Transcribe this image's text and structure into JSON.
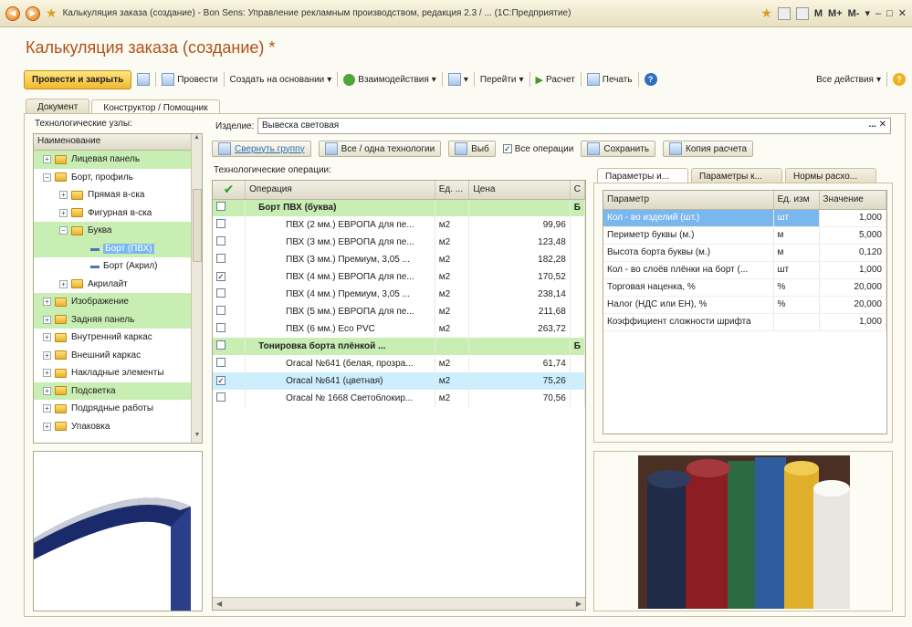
{
  "window": {
    "title": "Калькуляция заказа (создание) - Bon Sens: Управление рекламным производством, редакция 2.3 / ... (1С:Предприятие)",
    "controls": [
      "M",
      "M+",
      "M-"
    ]
  },
  "form": {
    "title": "Калькуляция заказа (создание) *"
  },
  "toolbar": {
    "post_close": "Провести и закрыть",
    "post": "Провести",
    "create_based": "Создать на основании",
    "interactions": "Взаимодействия",
    "goto": "Перейти",
    "calculate": "Расчет",
    "print": "Печать",
    "all_actions": "Все действия"
  },
  "tabs": [
    {
      "label": "Документ"
    },
    {
      "label": "Конструктор / Помощник"
    }
  ],
  "tree": {
    "label": "Технологические узлы:",
    "header": "Наименование",
    "items": [
      {
        "label": "Лицевая панель"
      },
      {
        "label": "Борт, профиль"
      },
      {
        "label": "Прямая в-ска"
      },
      {
        "label": "Фигурная в-ска"
      },
      {
        "label": "Буква"
      },
      {
        "label": "Борт (ПВХ)"
      },
      {
        "label": "Борт (Акрил)"
      },
      {
        "label": "Акрилайт"
      },
      {
        "label": "Изображение"
      },
      {
        "label": "Задняя панель"
      },
      {
        "label": "Внутренний каркас"
      },
      {
        "label": "Внешний каркас"
      },
      {
        "label": "Накладные элементы"
      },
      {
        "label": "Подсветка"
      },
      {
        "label": "Подрядные работы"
      },
      {
        "label": "Упаковка"
      }
    ]
  },
  "product": {
    "label": "Изделие:",
    "value": "Вывеска световая",
    "btn": "..."
  },
  "buttons": {
    "collapse": "Свернуть группу",
    "all_one": "Все / одна технологии",
    "choose": "Выб",
    "all_ops": "Все операции",
    "save": "Сохранить",
    "copy_calc": "Копия расчета"
  },
  "ops": {
    "label": "Технологические операции:",
    "columns": [
      "Операция",
      "Ед. ...",
      "Цена",
      "С"
    ],
    "rows": [
      {
        "name": "Борт ПВХ (буква)",
        "unit": "",
        "price": "",
        "c": "Б"
      },
      {
        "name": "ПВХ (2 мм.) ЕВРОПА для пе...",
        "unit": "м2",
        "price": "99,96",
        "c": ""
      },
      {
        "name": "ПВХ (3 мм.) ЕВРОПА для пе...",
        "unit": "м2",
        "price": "123,48",
        "c": ""
      },
      {
        "name": "ПВХ (3 мм.) Премиум, 3,05 ...",
        "unit": "м2",
        "price": "182,28",
        "c": ""
      },
      {
        "name": "ПВХ (4 мм.) ЕВРОПА для пе...",
        "unit": "м2",
        "price": "170,52",
        "c": ""
      },
      {
        "name": "ПВХ (4 мм.) Премиум, 3,05 ...",
        "unit": "м2",
        "price": "238,14",
        "c": ""
      },
      {
        "name": "ПВХ (5 мм.) ЕВРОПА для пе...",
        "unit": "м2",
        "price": "211,68",
        "c": ""
      },
      {
        "name": "ПВХ (6 мм.) Eco PVC",
        "unit": "м2",
        "price": "263,72",
        "c": ""
      },
      {
        "name": "Тонировка борта плёнкой ...",
        "unit": "",
        "price": "",
        "c": "Б"
      },
      {
        "name": "Oracal №641 (белая, прозра...",
        "unit": "м2",
        "price": "61,74",
        "c": ""
      },
      {
        "name": "Oracal №641 (цветная)",
        "unit": "м2",
        "price": "75,26",
        "c": ""
      },
      {
        "name": "Oracal № 1668 Светоблокир...",
        "unit": "м2",
        "price": "70,56",
        "c": ""
      }
    ]
  },
  "right_tabs": [
    {
      "label": "Параметры и..."
    },
    {
      "label": "Параметры к..."
    },
    {
      "label": "Нормы расхо..."
    }
  ],
  "params": {
    "columns": [
      "Параметр",
      "Ед. изм",
      "Значение"
    ],
    "rows": [
      {
        "name": "Кол - во изделий (шт.)",
        "unit": "шт",
        "value": "1,000"
      },
      {
        "name": "Периметр буквы (м.)",
        "unit": "м",
        "value": "5,000"
      },
      {
        "name": "Высота борта буквы (м.)",
        "unit": "м",
        "value": "0,120"
      },
      {
        "name": "Кол - во слоёв плёнки на борт (...",
        "unit": "шт",
        "value": "1,000"
      },
      {
        "name": "Торговая наценка, %",
        "unit": "%",
        "value": "20,000"
      },
      {
        "name": "Налог (НДС или ЕН), %",
        "unit": "%",
        "value": "20,000"
      },
      {
        "name": "Коэффициент сложности шрифта",
        "unit": "",
        "value": "1,000"
      }
    ]
  },
  "colors": {
    "accent": "#b0521a",
    "group_row": "#c8eeb4",
    "selection": "#7ab7ef",
    "row_highlight": "#cdeefc"
  }
}
